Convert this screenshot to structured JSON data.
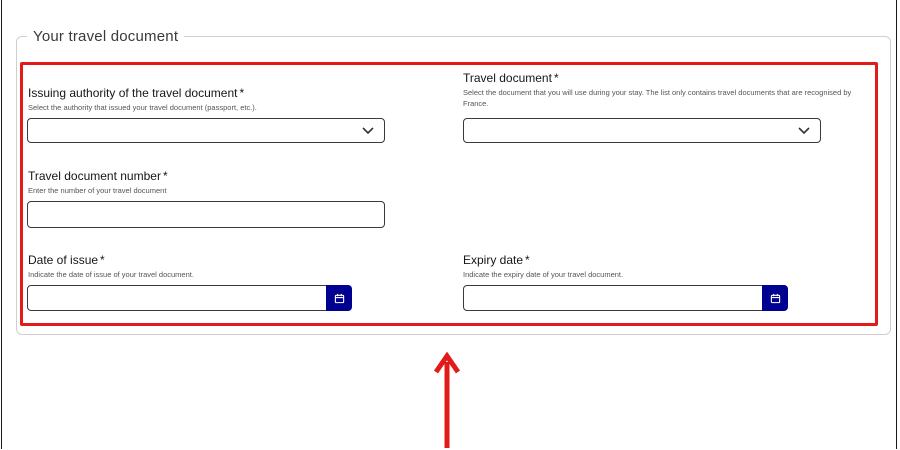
{
  "section": {
    "legend": "Your travel document"
  },
  "fields": {
    "issuing_authority": {
      "label": "Issuing authority of the travel document",
      "required": "*",
      "hint": "Select the authority that issued your travel document (passport, etc.).",
      "value": ""
    },
    "travel_document": {
      "label": "Travel document",
      "required": "*",
      "hint": "Select the document that you will use during your stay. The list only contains travel documents that are recognised by France.",
      "value": ""
    },
    "document_number": {
      "label": "Travel document number",
      "required": "*",
      "hint": "Enter the number of your travel document",
      "value": ""
    },
    "date_of_issue": {
      "label": "Date of issue",
      "required": "*",
      "hint": "Indicate the date of issue of your travel document.",
      "value": ""
    },
    "expiry_date": {
      "label": "Expiry date",
      "required": "*",
      "hint": "Indicate the expiry date of your travel document.",
      "value": ""
    }
  },
  "icons": {
    "dropdown": "chevron-down-icon",
    "calendar": "calendar-icon",
    "annotation": "arrow-up-icon"
  },
  "colors": {
    "highlight": "#e21a1a",
    "arrow": "#e21a1a",
    "date_button": "#000091"
  }
}
